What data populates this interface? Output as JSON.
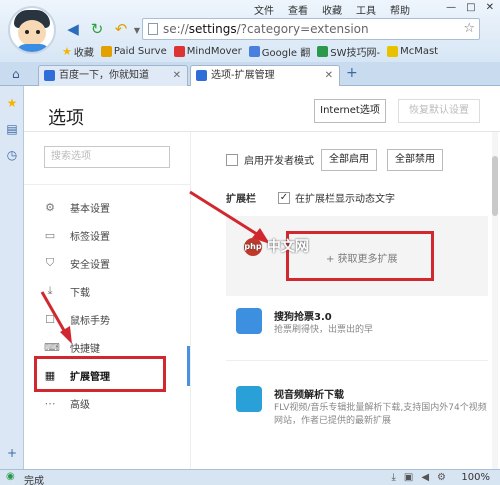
{
  "menu": [
    "文件",
    "查看",
    "收藏",
    "工具",
    "帮助"
  ],
  "address": {
    "prefix": "se://",
    "bold": "settings",
    "suffix": "/?category=extension"
  },
  "bookmarks": [
    {
      "label": "收藏",
      "color": "#f5b400"
    },
    {
      "label": "Paid Surve",
      "color": "#e2a100"
    },
    {
      "label": "MindMover",
      "color": "#d33"
    },
    {
      "label": "Google 翻",
      "color": "#4a7fe0"
    },
    {
      "label": "SW技巧网-",
      "color": "#2a9a4a"
    },
    {
      "label": "McMast",
      "color": "#e8c100"
    }
  ],
  "tabs": [
    {
      "label": "百度一下，你就知道",
      "color": "#2f6ed9"
    },
    {
      "label": "选项-扩展管理",
      "color": "#2f6ed9"
    }
  ],
  "page": {
    "title": "选项",
    "ie_button": "Internet选项",
    "restore_button": "恢复默认设置",
    "search_placeholder": "搜索选项"
  },
  "nav": [
    {
      "label": "基本设置",
      "icon": "gear-icon",
      "glyph": "⚙"
    },
    {
      "label": "标签设置",
      "icon": "tab-icon",
      "glyph": "▭"
    },
    {
      "label": "安全设置",
      "icon": "shield-icon",
      "glyph": "⛉"
    },
    {
      "label": "下载",
      "icon": "download-icon",
      "glyph": "⤓"
    },
    {
      "label": "鼠标手势",
      "icon": "mouse-icon",
      "glyph": "☐"
    },
    {
      "label": "快捷键",
      "icon": "keyboard-icon",
      "glyph": "⌨"
    },
    {
      "label": "扩展管理",
      "icon": "grid-icon",
      "glyph": "▦"
    },
    {
      "label": "高级",
      "icon": "more-icon",
      "glyph": "⋯"
    }
  ],
  "options": {
    "dev_mode": "启用开发者模式",
    "enable_all": "全部启用",
    "disable_all": "全部禁用",
    "ext_bar_label": "扩展栏",
    "ext_bar_option": "在扩展栏显示动态文字",
    "ext_bar_checked": "✓"
  },
  "get_more": "+ 获取更多扩展",
  "extensions": [
    {
      "name": "搜狗抢票3.0",
      "desc": "抢票刷得快，出票出的早",
      "color": "#3d8fe0"
    },
    {
      "name": "视音频解析下载",
      "desc": "FLV视频/音乐专辑批量解析下载,支持国内外74个视频网站，作者已提供的最新扩展",
      "color": "#2aa0d8"
    }
  ],
  "watermark": "中文网",
  "status": {
    "text": "完成",
    "zoom": "100%"
  }
}
